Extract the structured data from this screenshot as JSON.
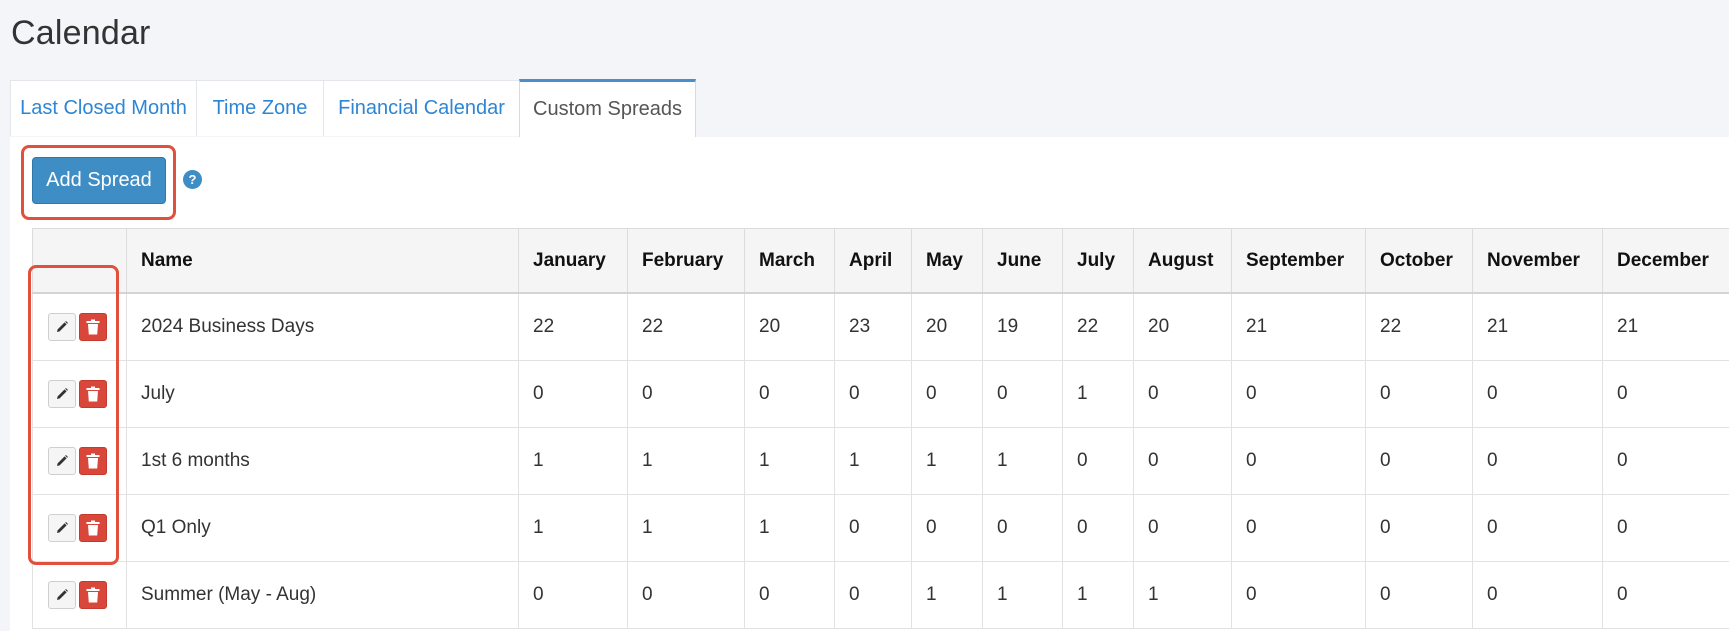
{
  "page": {
    "title": "Calendar"
  },
  "tabs": [
    {
      "label": "Last Closed Month",
      "active": false
    },
    {
      "label": "Time Zone",
      "active": false
    },
    {
      "label": "Financial Calendar",
      "active": false
    },
    {
      "label": "Custom Spreads",
      "active": true
    }
  ],
  "toolbar": {
    "add_label": "Add Spread",
    "help_glyph": "?"
  },
  "table": {
    "columns": [
      "",
      "Name",
      "January",
      "February",
      "March",
      "April",
      "May",
      "June",
      "July",
      "August",
      "September",
      "October",
      "November",
      "December"
    ],
    "rows": [
      {
        "name": "2024 Business Days",
        "values": [
          "22",
          "22",
          "20",
          "23",
          "20",
          "19",
          "22",
          "20",
          "21",
          "22",
          "21",
          "21"
        ]
      },
      {
        "name": "July",
        "values": [
          "0",
          "0",
          "0",
          "0",
          "0",
          "0",
          "1",
          "0",
          "0",
          "0",
          "0",
          "0"
        ]
      },
      {
        "name": "1st 6 months",
        "values": [
          "1",
          "1",
          "1",
          "1",
          "1",
          "1",
          "0",
          "0",
          "0",
          "0",
          "0",
          "0"
        ]
      },
      {
        "name": "Q1 Only",
        "values": [
          "1",
          "1",
          "1",
          "0",
          "0",
          "0",
          "0",
          "0",
          "0",
          "0",
          "0",
          "0"
        ]
      },
      {
        "name": "Summer (May - Aug)",
        "values": [
          "0",
          "0",
          "0",
          "0",
          "1",
          "1",
          "1",
          "1",
          "0",
          "0",
          "0",
          "0"
        ]
      }
    ]
  },
  "icons": {
    "edit": "pencil-icon",
    "delete": "trash-icon",
    "help": "help-icon"
  },
  "colors": {
    "accent": "#3e8dc4",
    "link": "#2d86d5",
    "danger": "#d9473a",
    "highlight": "#e0503c"
  }
}
